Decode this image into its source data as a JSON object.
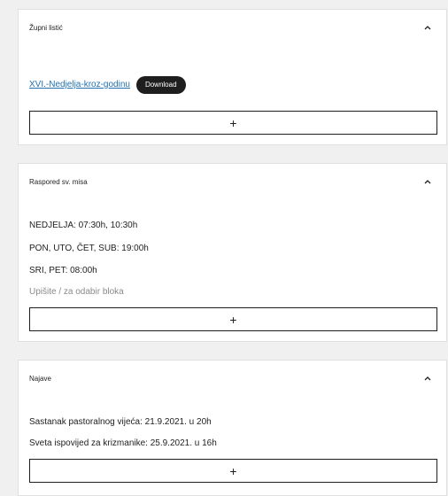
{
  "panels": [
    {
      "title": "Župni listić",
      "file": {
        "link_text": "XVI.-Nedjelja-kroz-godinu",
        "download_label": "Download"
      },
      "add_label": "+"
    },
    {
      "title": "Raspored sv. misa",
      "lines": [
        "NEDJELJA: 07:30h, 10:30h",
        "PON, UTO, ČET, SUB: 19:00h",
        "SRI, PET: 08:00h"
      ],
      "placeholder": "Upišite / za odabir bloka",
      "add_label": "+"
    },
    {
      "title": "Najave",
      "lines": [
        "Sastanak pastoralnog vijeća: 21.9.2021. u 20h",
        "Sveta ispovijed za krizmanike: 25.9.2021. u 16h"
      ],
      "add_label": "+"
    }
  ],
  "icons": {
    "collapse": "chevron-up-icon",
    "add": "plus-icon"
  },
  "colors": {
    "background": "#f0f0f1",
    "panel": "#ffffff",
    "link": "#2271b1",
    "button_dark": "#1e1e1e",
    "placeholder": "#8a8a8a"
  }
}
